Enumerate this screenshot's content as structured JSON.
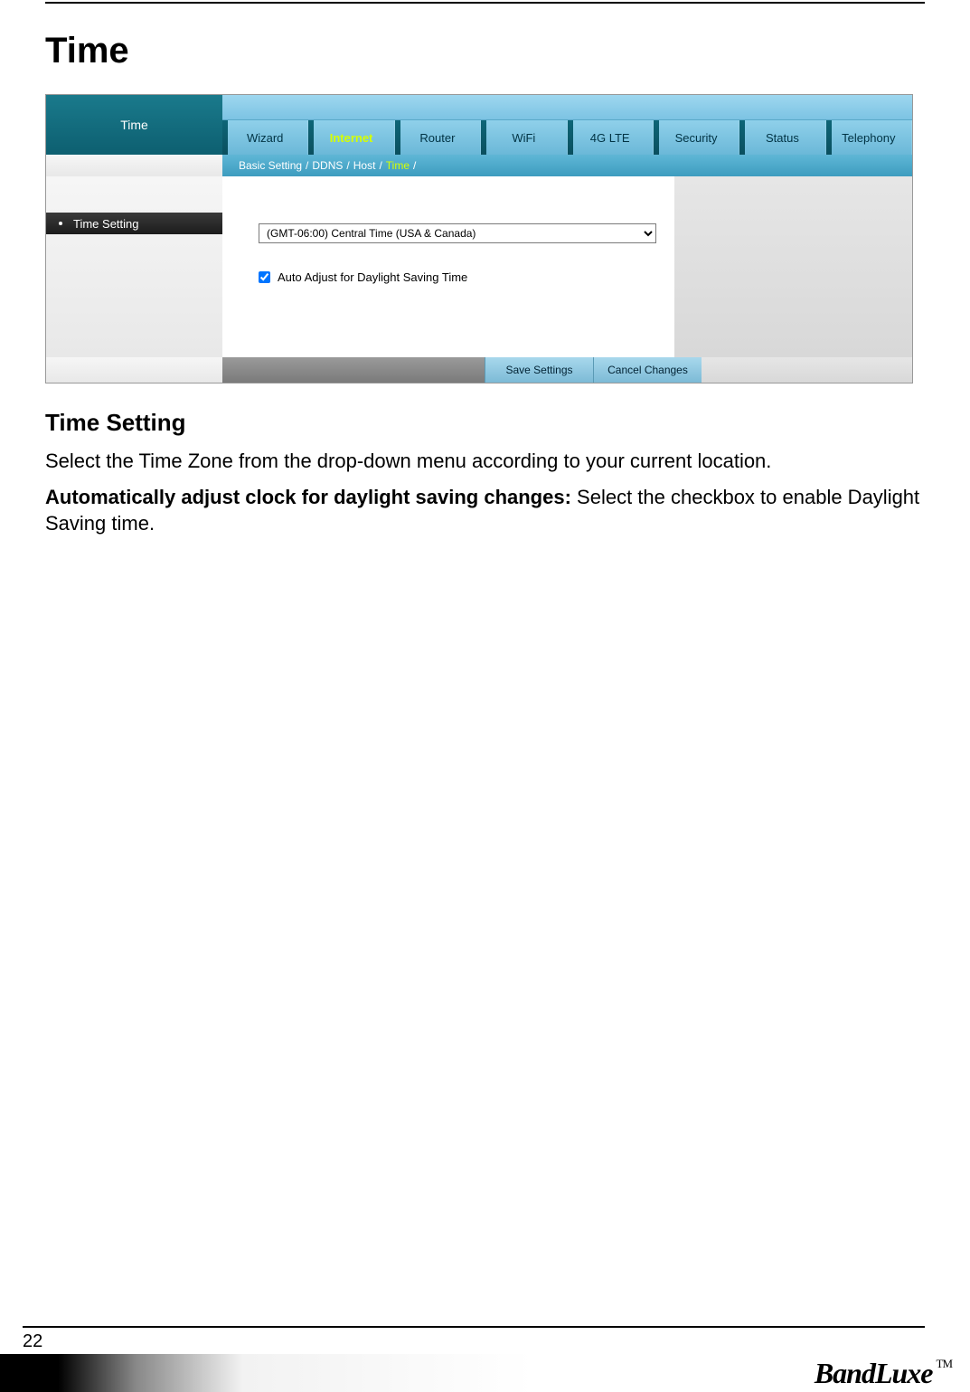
{
  "page_title": "Time",
  "screenshot": {
    "sidebar_title": "Time",
    "tabs": [
      "Wizard",
      "Internet",
      "Router",
      "WiFi",
      "4G LTE",
      "Security",
      "Status",
      "Telephony"
    ],
    "active_tab_index": 1,
    "breadcrumb": [
      "Basic Setting",
      "DDNS",
      "Host",
      "Time"
    ],
    "active_breadcrumb_index": 3,
    "sidebar_item": "Time Setting",
    "timezone_select": "(GMT-06:00) Central Time (USA & Canada)",
    "checkbox_label": "Auto Adjust for Daylight Saving Time",
    "checkbox_checked": true,
    "save_button": "Save Settings",
    "cancel_button": "Cancel Changes"
  },
  "section_title": "Time Setting",
  "para1": "Select the Time Zone from the drop-down menu according to your current location.",
  "para2_bold": "Automatically adjust clock for daylight saving changes:",
  "para2_rest": " Select the checkbox to enable Daylight Saving time.",
  "page_number": "22",
  "brand": "BandLuxe",
  "trademark": "TM"
}
